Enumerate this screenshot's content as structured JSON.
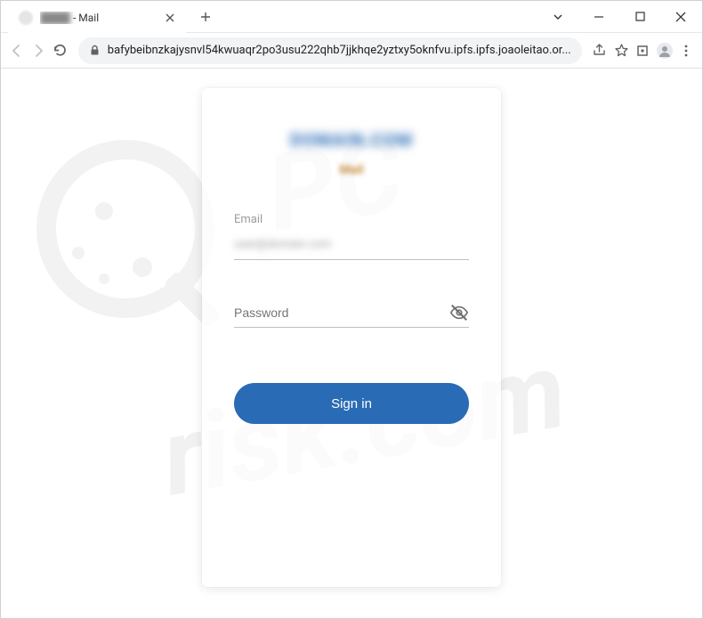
{
  "window": {
    "tab_title_suffix": " - Mail"
  },
  "toolbar": {
    "url": "bafybeibnzkajysnvl54kwuaqr2po3usu222qhb7jjkhqe2yztxy5oknfvu.ipfs.ipfs.joaoleitao.or..."
  },
  "card": {
    "header_line1": "DOMAIN.COM",
    "header_line2": "Mail"
  },
  "form": {
    "email_label": "Email",
    "email_value": "user@domain.com",
    "password_placeholder": "Password",
    "signin_label": "Sign in"
  },
  "watermark": {
    "text1": "PC",
    "text2": "risk.com"
  }
}
